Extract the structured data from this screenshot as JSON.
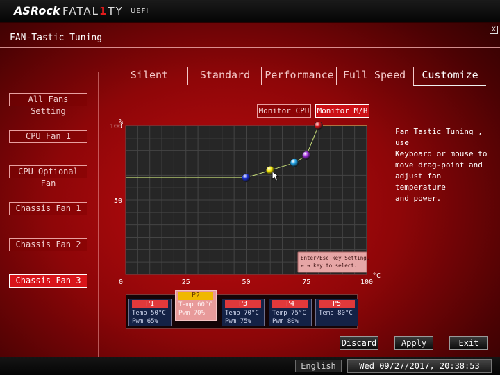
{
  "header": {
    "brand": "ASRock",
    "product_prefix": "FATAL",
    "product_one": "1",
    "product_suffix": "TY",
    "uefi": "UEFI",
    "close_label": "X"
  },
  "page_title": "FAN-Tastic Tuning",
  "tabs": [
    {
      "label": "Silent",
      "active": false
    },
    {
      "label": "Standard",
      "active": false
    },
    {
      "label": "Performance",
      "active": false
    },
    {
      "label": "Full Speed",
      "active": false
    },
    {
      "label": "Customize",
      "active": true
    }
  ],
  "sidebar": {
    "items": [
      {
        "label": "All Fans Setting",
        "active": false
      },
      {
        "label": "CPU Fan 1",
        "active": false
      },
      {
        "label": "CPU Optional Fan",
        "active": false
      },
      {
        "label": "Chassis Fan 1",
        "active": false
      },
      {
        "label": "Chassis Fan 2",
        "active": false
      },
      {
        "label": "Chassis Fan 3",
        "active": true
      }
    ]
  },
  "monitor": {
    "cpu_label": "Monitor CPU",
    "mb_label": "Monitor M/B",
    "active": "mb"
  },
  "help_text": [
    "Fan Tastic Tuning , use",
    "Keyboard or mouse to",
    "move drag-point and",
    "adjust fan temperature",
    "and power."
  ],
  "chart_data": {
    "type": "line",
    "xlabel": "°C",
    "ylabel": "%",
    "xlim": [
      0,
      100
    ],
    "ylim": [
      0,
      100
    ],
    "x_ticks": [
      "0",
      "25",
      "50",
      "75",
      "100"
    ],
    "y_ticks": [
      "50",
      "100"
    ],
    "grid": true,
    "points": [
      {
        "name": "P1",
        "temp": 50,
        "pwm": 65,
        "color": "#1a2fd6"
      },
      {
        "name": "P2",
        "temp": 60,
        "pwm": 70,
        "color": "#f2e600"
      },
      {
        "name": "P3",
        "temp": 70,
        "pwm": 75,
        "color": "#1e9ee0"
      },
      {
        "name": "P4",
        "temp": 75,
        "pwm": 80,
        "color": "#9b28d8"
      },
      {
        "name": "P5",
        "temp": 80,
        "pwm": 100,
        "color": "#d8141a"
      }
    ],
    "line_color": "#c8e07a",
    "tooltip": [
      "Enter/Esc key Setting.",
      "← → key to select."
    ]
  },
  "point_panel": {
    "temp_label": "Temp",
    "pwm_label": "Pwm",
    "selected": "P2",
    "items": [
      {
        "name": "P1",
        "temp": "50°C",
        "pwm": "65%"
      },
      {
        "name": "P2",
        "temp": "60°C",
        "pwm": "70%"
      },
      {
        "name": "P3",
        "temp": "70°C",
        "pwm": "75%"
      },
      {
        "name": "P4",
        "temp": "75°C",
        "pwm": "80%"
      },
      {
        "name": "P5",
        "temp": "80°C",
        "pwm": ""
      }
    ]
  },
  "actions": {
    "discard": "Discard",
    "apply": "Apply",
    "exit": "Exit"
  },
  "footer": {
    "language": "English",
    "datetime": "Wed 09/27/2017, 20:38:53"
  }
}
